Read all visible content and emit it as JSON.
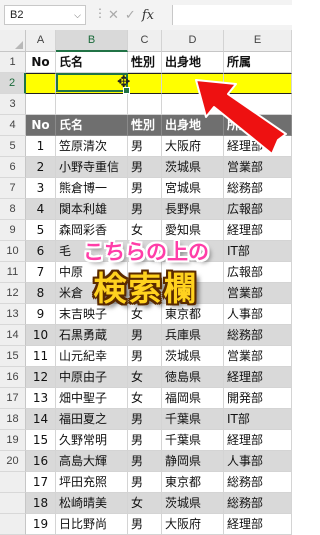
{
  "formula_bar": {
    "name_box": "B2",
    "name_box_arrow": "⌵",
    "cancel_icon": "✕",
    "enter_icon": "✓",
    "fx_label": "fx",
    "formula_value": ""
  },
  "columns": [
    "A",
    "B",
    "C",
    "D",
    "E"
  ],
  "row_numbers": [
    "1",
    "2",
    "3",
    "4",
    "5",
    "6",
    "7",
    "8",
    "9",
    "10",
    "11",
    "12",
    "13",
    "14",
    "15",
    "16",
    "17",
    "18",
    "19",
    "20"
  ],
  "table": {
    "row1": [
      "No",
      "氏名",
      "性別",
      "出身地",
      "所属"
    ],
    "row2": [
      "",
      "",
      "",
      "",
      ""
    ],
    "row3": [
      "",
      "",
      "",
      "",
      ""
    ],
    "header": [
      "No",
      "氏名",
      "性別",
      "出身地",
      "所属"
    ],
    "rows": [
      [
        "1",
        "笠原清次",
        "男",
        "大阪府",
        "経理部"
      ],
      [
        "2",
        "小野寺重信",
        "男",
        "茨城県",
        "営業部"
      ],
      [
        "3",
        "熊倉博一",
        "男",
        "宮城県",
        "総務部"
      ],
      [
        "4",
        "関本利雄",
        "男",
        "長野県",
        "広報部"
      ],
      [
        "5",
        "森岡彩香",
        "女",
        "愛知県",
        "経理部"
      ],
      [
        "6",
        "毛",
        "",
        "",
        "IT部"
      ],
      [
        "7",
        "中原",
        "",
        "",
        "広報部"
      ],
      [
        "8",
        "米倉",
        "",
        "",
        "営業部"
      ],
      [
        "9",
        "末吉映子",
        "女",
        "東京都",
        "人事部"
      ],
      [
        "10",
        "石黒勇蔵",
        "男",
        "兵庫県",
        "総務部"
      ],
      [
        "11",
        "山元紀幸",
        "男",
        "茨城県",
        "営業部"
      ],
      [
        "12",
        "中原由子",
        "女",
        "徳島県",
        "経理部"
      ],
      [
        "13",
        "畑中聖子",
        "女",
        "福岡県",
        "開発部"
      ],
      [
        "14",
        "福田夏之",
        "男",
        "千葉県",
        "IT部"
      ],
      [
        "15",
        "久野常明",
        "男",
        "千葉県",
        "経理部"
      ],
      [
        "16",
        "高島大輝",
        "男",
        "静岡県",
        "人事部"
      ],
      [
        "17",
        "坪田充照",
        "男",
        "東京都",
        "総務部"
      ],
      [
        "18",
        "松崎晴美",
        "女",
        "茨城県",
        "総務部"
      ],
      [
        "19",
        "日比野尚",
        "男",
        "大阪府",
        "経理部"
      ]
    ]
  },
  "caption": {
    "line1": "こちらの上の",
    "line2": "検索欄"
  },
  "colors": {
    "highlight": "#ffff00",
    "header_bg": "#6f6f6f",
    "stripe": "#d9d9d9",
    "arrow": "#ee1111",
    "selection": "#217346"
  }
}
